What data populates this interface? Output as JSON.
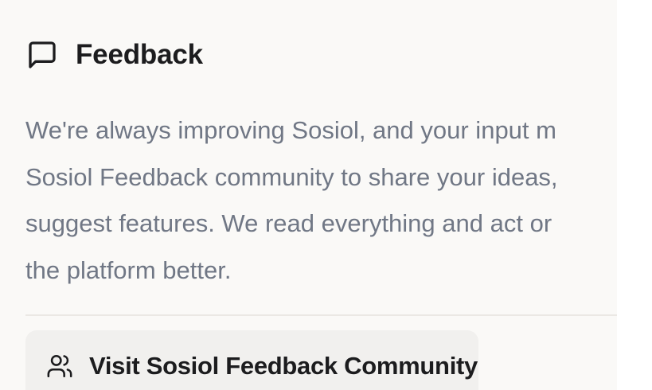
{
  "feedback": {
    "title": "Feedback",
    "icon": "message-square-icon",
    "description_lines": [
      "We're always improving Sosiol, and your input m",
      "Sosiol Feedback community to share your ideas,",
      "suggest features. We read everything and act or",
      "the platform better."
    ],
    "button": {
      "label": "Visit Sosiol Feedback Community",
      "icon": "users-icon"
    }
  },
  "colors": {
    "card_background": "#faf9f7",
    "title_text": "#1c1c1e",
    "body_text": "#707785",
    "divider": "#ebe8e4",
    "button_background": "#f1f0ee"
  }
}
